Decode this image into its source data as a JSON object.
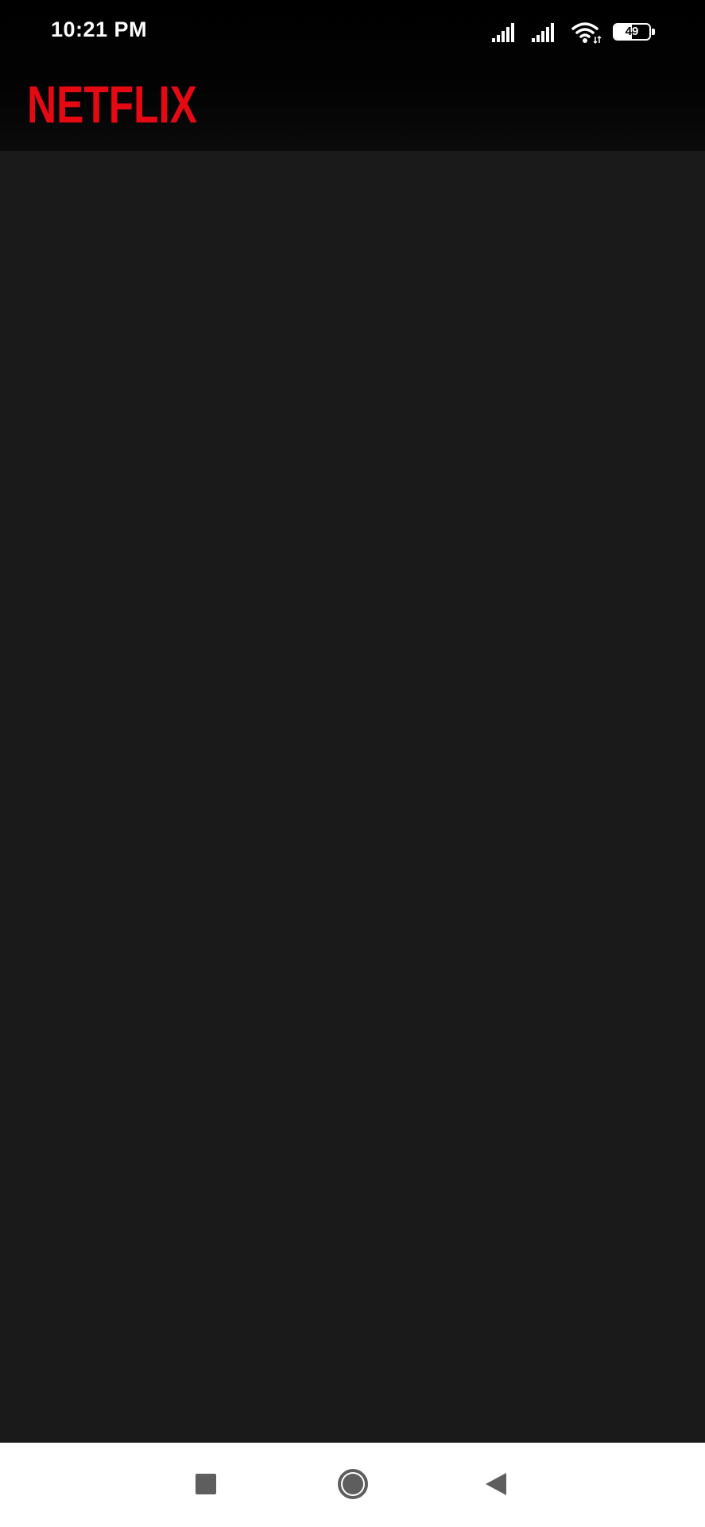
{
  "status_bar": {
    "time": "10:21 PM",
    "battery_level": "49",
    "battery_fraction": 0.49,
    "icons": [
      "signal-icon-sim1",
      "signal-icon-sim2",
      "wifi-icon",
      "battery-icon"
    ]
  },
  "app_bar": {
    "logo_text": "NETFLIX",
    "brand_color": "#E50914"
  },
  "theme": {
    "header_background": "#000000",
    "content_background": "#1a1a1a",
    "navbar_background": "#ffffff",
    "nav_icon_color": "#5e5e5e"
  },
  "nav_bar": {
    "buttons": [
      "recents-button",
      "home-button",
      "back-button"
    ]
  }
}
